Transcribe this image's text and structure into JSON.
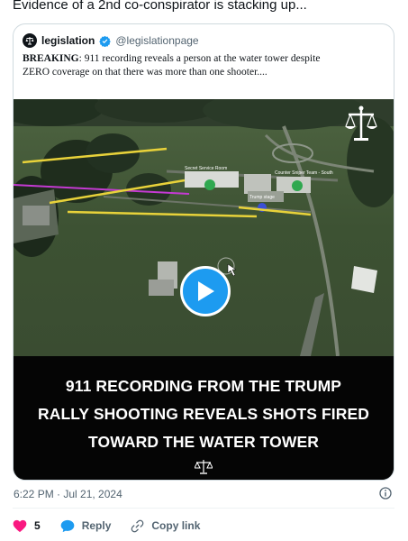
{
  "tweet": {
    "text": "Evidence of a 2nd co-conspirator is stacking up...",
    "timestamp": "6:22 PM · Jul 21, 2024"
  },
  "quote": {
    "display_name": "legislation",
    "handle": "@legislationpage",
    "verified": true,
    "breaking_label": "BREAKING",
    "body_line1": ": 911 recording reveals a person at the water tower despite",
    "body_line2": "ZERO coverage on that there was more than one shooter...."
  },
  "media": {
    "caption_line1": "911 RECORDING FROM THE TRUMP",
    "caption_line2": "RALLY SHOOTING REVEALS SHOTS FIRED",
    "caption_line3": "TOWARD THE WATER TOWER",
    "map_label_1": "Secret Service Room",
    "map_label_2": "Counter Sniper Team - South",
    "map_label_3": "Trump stage",
    "play_icon": "play-icon",
    "logo_icon": "scales-icon"
  },
  "actions": {
    "likes_count": "5",
    "reply_label": "Reply",
    "copy_link_label": "Copy link"
  },
  "colors": {
    "accent": "#1d9bf0",
    "like": "#f91880",
    "muted": "#536471",
    "border": "#cfd9de"
  }
}
